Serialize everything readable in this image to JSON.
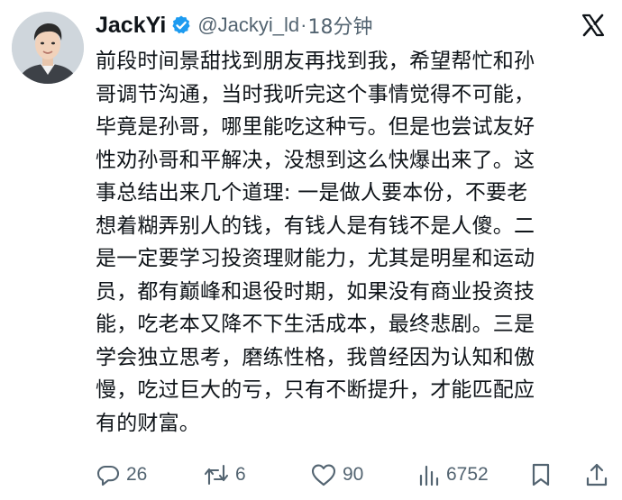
{
  "author": {
    "name": "JackYi",
    "handle": "@Jackyi_ld",
    "separator": "·",
    "time": "18分钟"
  },
  "tweet": {
    "lines": [
      "前段时间景甜找到朋友再找到我，希望帮忙和孙",
      "哥调节沟通，当时我听完这个事情觉得不可能，",
      "毕竟是孙哥，哪里能吃这种亏。但是也尝试友好",
      "性劝孙哥和平解决，没想到这么快爆出来了。这",
      "事总结出来几个道理: 一是做人要本份，不要老",
      "想着糊弄别人的钱，有钱人是有钱不是人傻。二",
      "是一定要学习投资理财能力，尤其是明星和运动",
      "员，都有巅峰和退役时期，如果没有商业投资技",
      "能，吃老本又降不下生活成本，最终悲剧。三是",
      "学会独立思考，磨练性格，我曾经因为认知和傲",
      "慢，吃过巨大的亏，只有不断提升，才能匹配应",
      "有的财富。"
    ]
  },
  "actions": {
    "replies": "26",
    "reposts": "6",
    "likes": "90",
    "views": "6752"
  },
  "colors": {
    "text": "#0f1419",
    "secondary": "#536471",
    "verified": "#1d9bf0"
  },
  "icons": [
    "avatar",
    "verified-badge-icon",
    "x-logo-icon",
    "reply-icon",
    "repost-icon",
    "like-icon",
    "views-icon",
    "bookmark-icon",
    "share-icon"
  ]
}
